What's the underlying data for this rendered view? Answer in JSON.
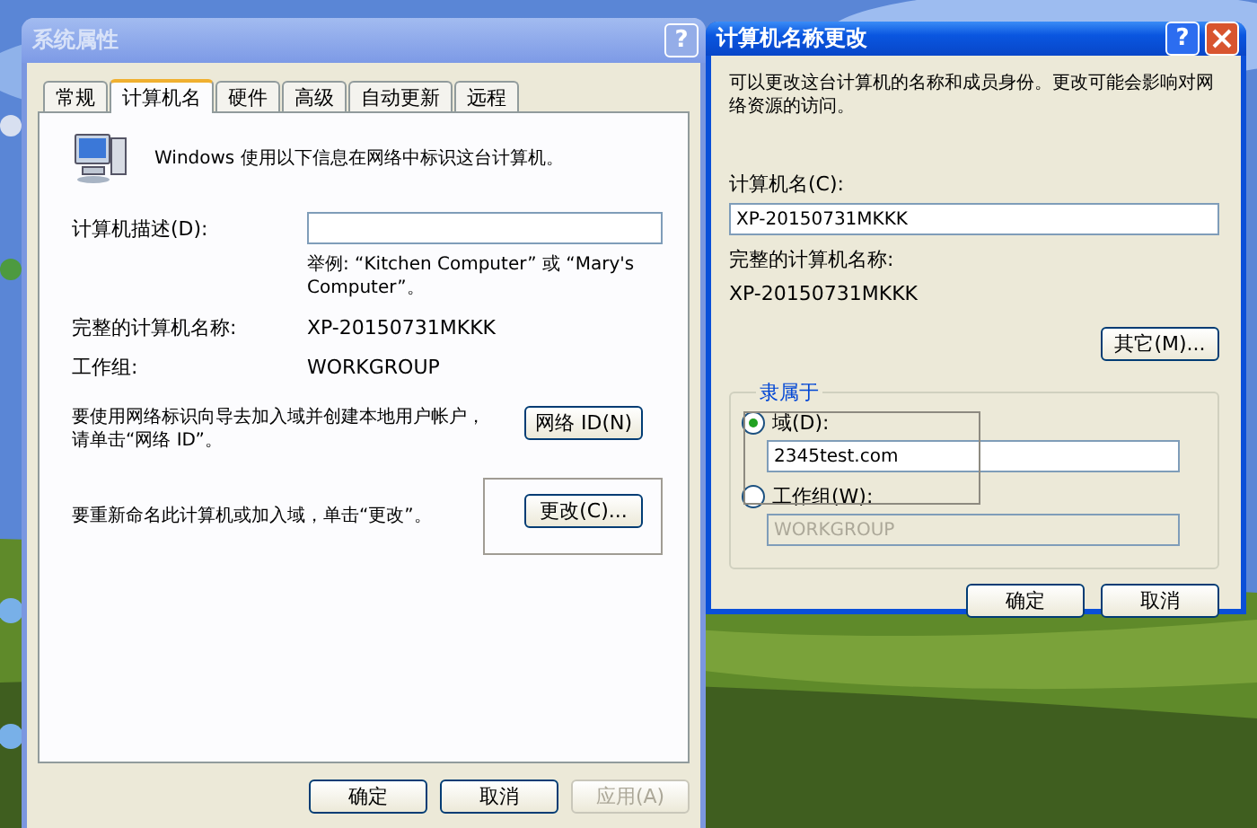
{
  "system_properties": {
    "title": "系统属性",
    "help": "?",
    "active": false,
    "tabs": [
      {
        "label": "常规",
        "selected": false
      },
      {
        "label": "计算机名",
        "selected": true
      },
      {
        "label": "硬件",
        "selected": false
      },
      {
        "label": "高级",
        "selected": false
      },
      {
        "label": "自动更新",
        "selected": false
      },
      {
        "label": "远程",
        "selected": false
      }
    ],
    "intro": "Windows 使用以下信息在网络中标识这台计算机。",
    "description": {
      "label": "计算机描述(D):"
    },
    "example": "举例: “Kitchen Computer” 或 “Mary's Computer”。",
    "full_name": {
      "label": "完整的计算机名称:",
      "value": "XP-20150731MKKK"
    },
    "workgroup": {
      "label": "工作组:",
      "value": "WORKGROUP"
    },
    "network_id": {
      "text": "要使用网络标识向导去加入域并创建本地用户帐户，请单击“网络 ID”。",
      "button": "网络 ID(N)"
    },
    "rename": {
      "text": "要重新命名此计算机或加入域，单击“更改”。",
      "button": "更改(C)..."
    },
    "buttons": [
      {
        "label": "确定",
        "disabled": false
      },
      {
        "label": "取消",
        "disabled": false
      },
      {
        "label": "应用(A)",
        "disabled": true
      }
    ]
  },
  "name_change": {
    "title": "计算机名称更改",
    "help": "?",
    "active": true,
    "intro": "可以更改这台计算机的名称和成员身份。更改可能会影响对网络资源的访问。",
    "computer_name": {
      "label": "计算机名(C):",
      "value": "XP-20150731MKKK"
    },
    "full_name": {
      "label": "完整的计算机名称:",
      "value": "XP-20150731MKKK"
    },
    "more_button": "其它(M)...",
    "member_of": {
      "title": "隶属于",
      "options": [
        {
          "label": "域(D):",
          "selected": true,
          "value": "2345test.com"
        },
        {
          "label": "工作组(W):",
          "selected": false,
          "value": "WORKGROUP"
        }
      ]
    },
    "buttons": [
      {
        "label": "确定",
        "disabled": false
      },
      {
        "label": "取消",
        "disabled": false
      }
    ]
  }
}
